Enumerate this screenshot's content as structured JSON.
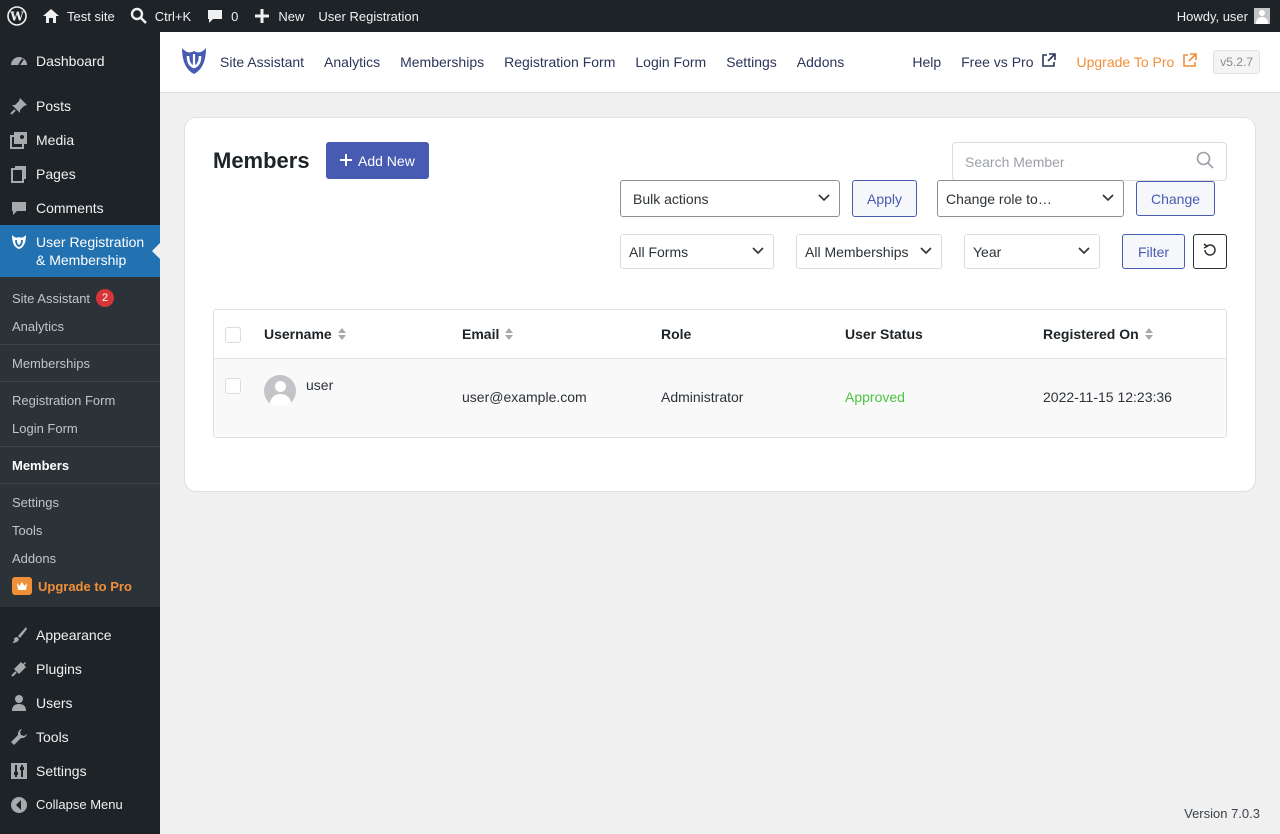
{
  "adminbar": {
    "site_name": "Test site",
    "search_shortcut": "Ctrl+K",
    "comments_count": "0",
    "new_label": "New",
    "plugin_label": "User Registration",
    "howdy": "Howdy, user"
  },
  "sidebar": {
    "dashboard": "Dashboard",
    "posts": "Posts",
    "media": "Media",
    "pages": "Pages",
    "comments": "Comments",
    "current_line1": "User Registration",
    "current_line2": "& Membership",
    "submenu": {
      "site_assistant": "Site Assistant",
      "site_assistant_badge": "2",
      "analytics": "Analytics",
      "memberships": "Memberships",
      "registration_form": "Registration Form",
      "login_form": "Login Form",
      "members": "Members",
      "settings": "Settings",
      "tools": "Tools",
      "addons": "Addons",
      "upgrade": "Upgrade to Pro"
    },
    "appearance": "Appearance",
    "plugins": "Plugins",
    "users": "Users",
    "tools": "Tools",
    "settings": "Settings",
    "collapse": "Collapse Menu"
  },
  "plugin_header": {
    "nav": [
      "Site Assistant",
      "Analytics",
      "Memberships",
      "Registration Form",
      "Login Form",
      "Settings",
      "Addons"
    ],
    "help": "Help",
    "free_vs_pro": "Free vs Pro",
    "upgrade": "Upgrade To Pro",
    "version": "v5.2.7"
  },
  "members": {
    "title": "Members",
    "add_new": "Add New",
    "search_placeholder": "Search Member",
    "bulk_actions": "Bulk actions",
    "apply": "Apply",
    "change_role": "Change role to…",
    "change": "Change",
    "all_forms": "All Forms",
    "all_memberships": "All Memberships",
    "year": "Year",
    "filter": "Filter"
  },
  "table": {
    "headers": {
      "username": "Username",
      "email": "Email",
      "role": "Role",
      "user_status": "User Status",
      "registered_on": "Registered On"
    },
    "rows": [
      {
        "username": "user",
        "email": "user@example.com",
        "role": "Administrator",
        "status": "Approved",
        "registered_on": "2022-11-15 12:23:36"
      }
    ]
  },
  "footer": {
    "version": "Version 7.0.3"
  },
  "colors": {
    "accent": "#475bb2",
    "wp_blue": "#2271b1",
    "upgrade_orange": "#f18f39",
    "approved_green": "#4cc340",
    "badge_red": "#d63638"
  }
}
